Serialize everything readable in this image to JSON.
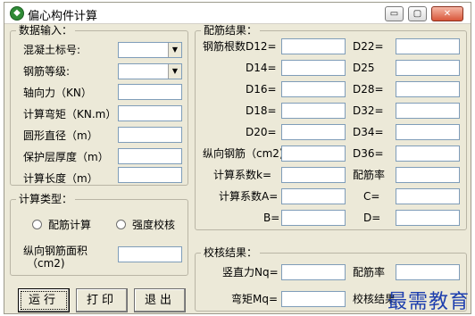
{
  "window": {
    "title": "偏心构件计算",
    "min_label": "▭",
    "max_label": "▢",
    "close_label": "✕"
  },
  "input_group": {
    "title": "数据输入：",
    "concrete_label": "混凝土标号:",
    "concrete_value": "",
    "steel_label": "钢筋等级:",
    "steel_value": "",
    "axial_label": "轴向力（KN）",
    "moment_label": "计算弯矩（KN.m）",
    "diameter_label": "圆形直径（m）",
    "cover_label": "保护层厚度（m）",
    "length_label": "计算长度（m）"
  },
  "calc_type": {
    "title": "计算类型：",
    "option_design": "配筋计算",
    "option_check": "强度校核",
    "area_label_1": "纵向钢筋面积",
    "area_label_2": "（cm2)"
  },
  "buttons": {
    "run": "运行",
    "print": "打印",
    "exit": "退出"
  },
  "result_group": {
    "title": "配筋结果：",
    "d12": "钢筋根数D12=",
    "d14": "D14=",
    "d16": "D16=",
    "d18": "D18=",
    "d20": "D20=",
    "d22": "D22=",
    "d25": "D25",
    "d28": "D28=",
    "d32": "D32=",
    "d34": "D34=",
    "d36": "D36=",
    "long_steel": "纵向钢筋（cm2)",
    "coef_k": "计算系数k=",
    "ratio": "配筋率",
    "coef_a": "计算系数A=",
    "c": "C=",
    "b": "B=",
    "d": "D="
  },
  "check_group": {
    "title": "校核结果：",
    "nq": "竖直力Nq=",
    "ratio": "配筋率",
    "mq": "弯矩Mq=",
    "check_result": "校核结果"
  },
  "watermark": "最需教育"
}
